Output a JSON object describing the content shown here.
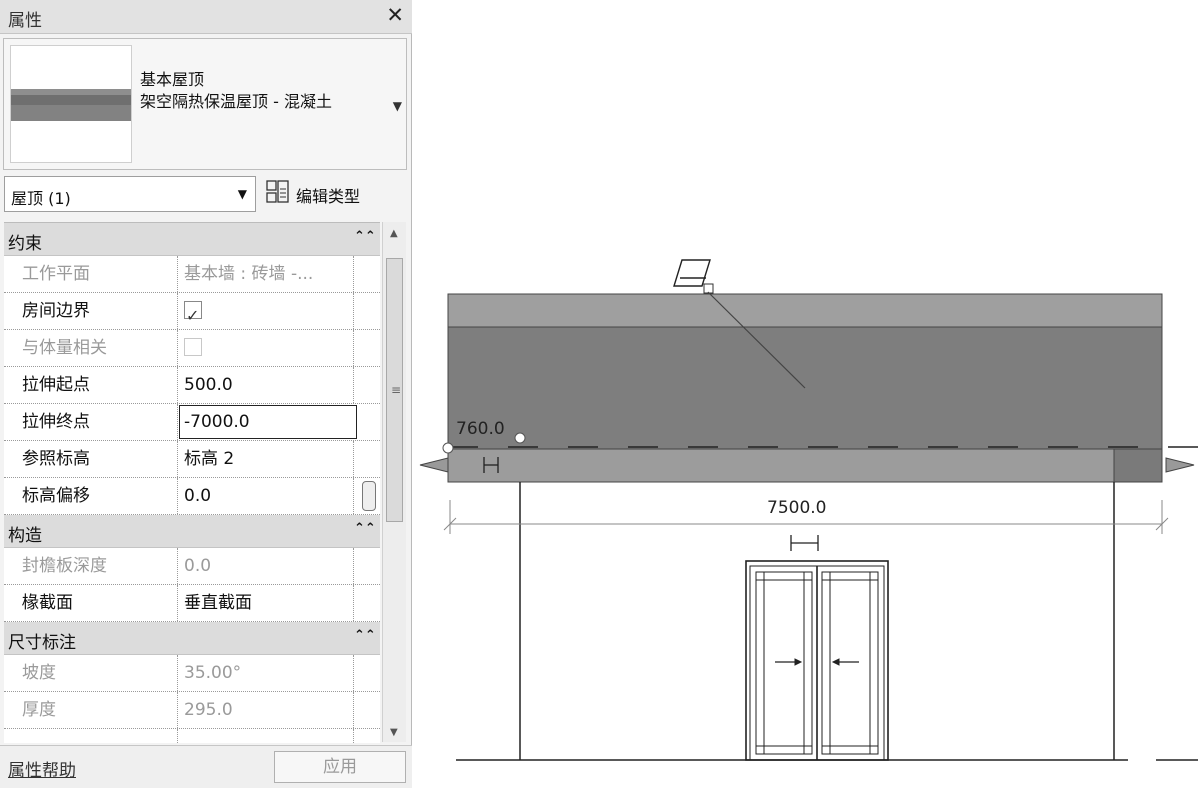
{
  "panel": {
    "title": "属性",
    "close_icon": "close-icon",
    "type_family": "基本屋顶",
    "type_name": "架空隔热保温屋顶 - 混凝土",
    "selector_label": "屋顶 (1)",
    "edit_type_label": "编辑类型"
  },
  "groups": [
    {
      "name": "约束",
      "rows": [
        {
          "label": "工作平面",
          "value": "基本墙 : 砖墙 -...",
          "state": "readonly"
        },
        {
          "label": "房间边界",
          "value": "",
          "checkbox": true,
          "checked": true
        },
        {
          "label": "与体量相关",
          "value": "",
          "checkbox": true,
          "checked": false,
          "state": "readonly"
        },
        {
          "label": "拉伸起点",
          "value": "500.0"
        },
        {
          "label": "拉伸终点",
          "value": "-7000.0",
          "state": "editing"
        },
        {
          "label": "参照标高",
          "value": "标高 2"
        },
        {
          "label": "标高偏移",
          "value": "0.0"
        }
      ]
    },
    {
      "name": "构造",
      "rows": [
        {
          "label": "封檐板深度",
          "value": "0.0",
          "state": "readonly"
        },
        {
          "label": "椽截面",
          "value": "垂直截面"
        }
      ]
    },
    {
      "name": "尺寸标注",
      "rows": [
        {
          "label": "坡度",
          "value": "35.00°",
          "state": "readonly"
        },
        {
          "label": "厚度",
          "value": "295.0",
          "state": "readonly"
        }
      ]
    }
  ],
  "footer": {
    "help_link": "属性帮助",
    "apply_button": "应用"
  },
  "canvas": {
    "dim_overhang": "760.0",
    "dim_width": "7500.0"
  }
}
